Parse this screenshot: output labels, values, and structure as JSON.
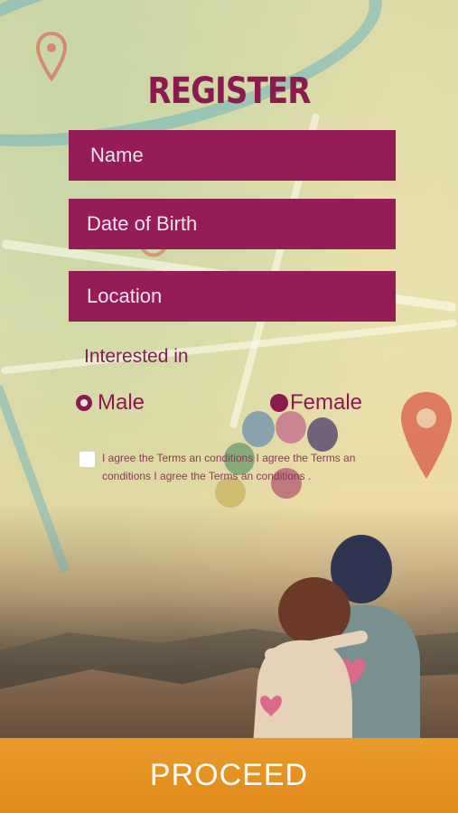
{
  "screen": {
    "title": "REGISTER"
  },
  "form": {
    "name_placeholder": "Name",
    "dob_placeholder": "Date of Birth",
    "location_placeholder": "Location",
    "interested_label": "Interested in",
    "gender_options": [
      {
        "label": "Male",
        "selected": true
      },
      {
        "label": "Female",
        "selected": false
      }
    ],
    "terms_text": "I agree the Terms an conditions I agree the Terms an conditions I agree the Terms an conditions .",
    "terms_checked": false
  },
  "footer": {
    "proceed_label": "PROCEED"
  },
  "colors": {
    "field_bg": "#961c58",
    "title": "#8b1a4f",
    "proceed_bg": "#e6962a"
  },
  "icons": [
    "map-pin-icon",
    "radio-selected-icon",
    "radio-unselected-icon",
    "checkbox-icon"
  ]
}
